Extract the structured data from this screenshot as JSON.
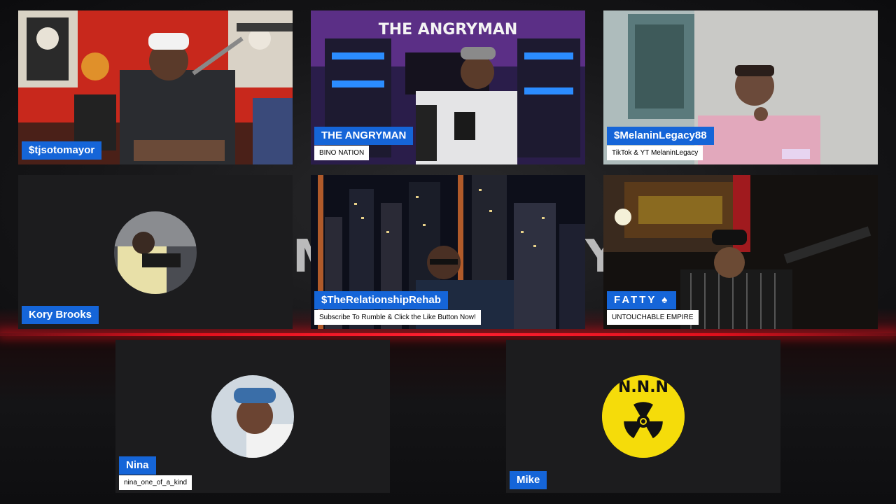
{
  "participants": [
    {
      "name": "$tjsotomayor"
    },
    {
      "name": "THE ANGRYMAN",
      "subtitle": "BINO NATION",
      "sign": "THE ANGRYMAN"
    },
    {
      "name": "$MelaninLegacy88",
      "subtitle": "TikTok & YT MelaninLegacy"
    },
    {
      "name": "Kory Brooks"
    },
    {
      "name": "$TheRelationshipRehab",
      "subtitle": "Subscribe To Rumble & Click the Like Button Now!"
    },
    {
      "name": "FATTY ♠",
      "subtitle": "UNTOUCHABLE EMPIRE"
    },
    {
      "name": "Nina",
      "subtitle": "nina_one_of_a_kind"
    },
    {
      "name": "Mike",
      "avatar_text": "N.N.N"
    }
  ],
  "background": {
    "watermark_left": "M",
    "watermark_right": "Y"
  },
  "colors": {
    "name_tag": "#1565d8",
    "accent_line": "#e0101c",
    "radiation_yellow": "#f5dc0a"
  }
}
